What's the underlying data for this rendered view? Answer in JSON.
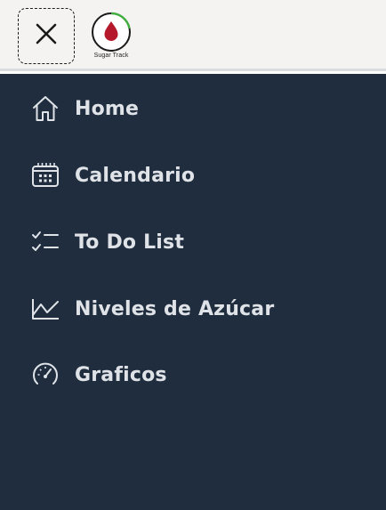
{
  "header": {
    "logo_text": "Sugar Track",
    "close_icon": "close-icon",
    "logo_icon": "blood-drop-icon",
    "colors": {
      "topbar_bg": "#f4f3f1",
      "logo_accent": "#3fae3f",
      "drop": "#b5182b"
    }
  },
  "sidebar": {
    "background": "#1f2d3e",
    "items": [
      {
        "label": "Home",
        "icon": "home-icon"
      },
      {
        "label": "Calendario",
        "icon": "calendar-icon"
      },
      {
        "label": "To Do List",
        "icon": "checklist-icon"
      },
      {
        "label": "Niveles de Azúcar",
        "icon": "line-chart-icon"
      },
      {
        "label": "Graficos",
        "icon": "gauge-icon"
      }
    ]
  }
}
